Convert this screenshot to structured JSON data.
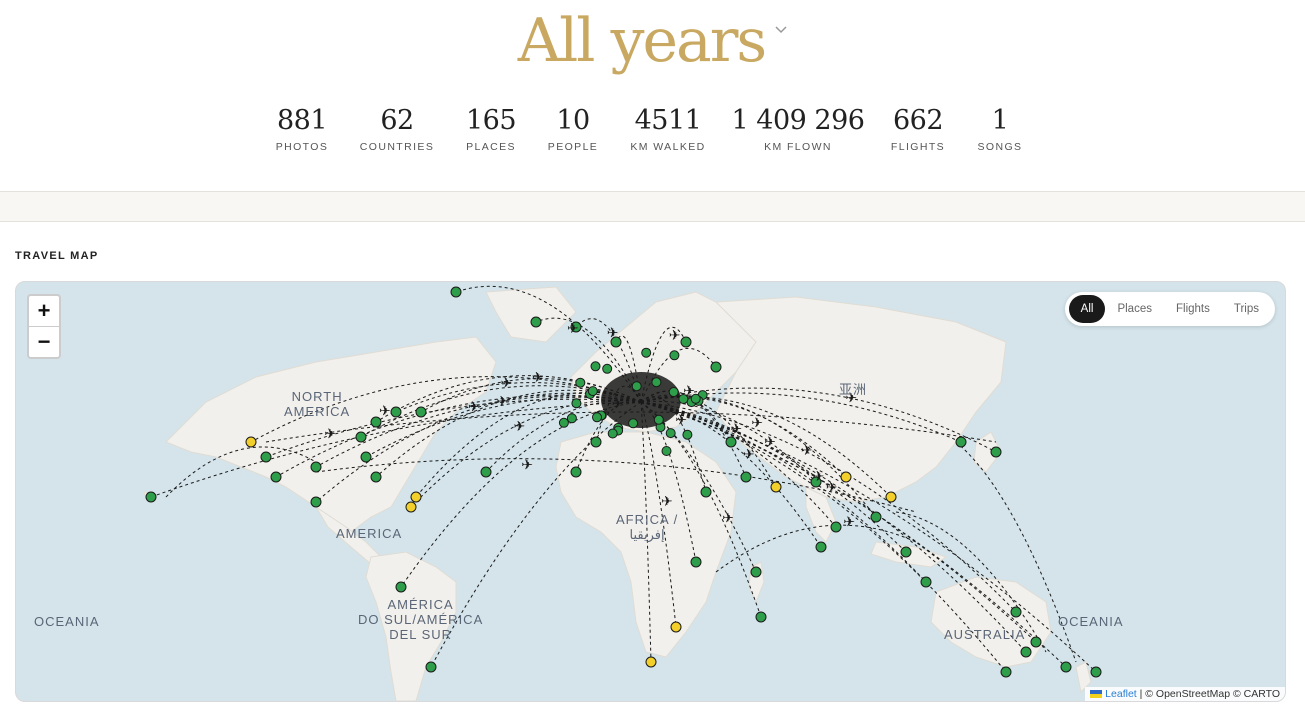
{
  "header": {
    "title": "All years"
  },
  "stats": [
    {
      "value": "881",
      "label": "PHOTOS"
    },
    {
      "value": "62",
      "label": "COUNTRIES"
    },
    {
      "value": "165",
      "label": "PLACES"
    },
    {
      "value": "10",
      "label": "PEOPLE"
    },
    {
      "value": "4511",
      "label": "KM WALKED"
    },
    {
      "value": "1 409 296",
      "label": "KM FLOWN"
    },
    {
      "value": "662",
      "label": "FLIGHTS"
    },
    {
      "value": "1",
      "label": "SONGS"
    }
  ],
  "section": {
    "title": "TRAVEL MAP"
  },
  "map": {
    "zoom_in": "+",
    "zoom_out": "−",
    "filters": [
      "All",
      "Places",
      "Flights",
      "Trips"
    ],
    "active_filter": "All",
    "labels": {
      "north_america": [
        "NORTH",
        "AMERICA"
      ],
      "central_america": "AMERICA",
      "south_america": [
        "AMÉRICA",
        "DO SUL/AMÉRICA",
        "DEL SUR"
      ],
      "africa": [
        "AFRICA /",
        "إفريقيا"
      ],
      "asia": "亚洲",
      "australia": "AUSTRALIA",
      "oceania_left": "OCEANIA",
      "oceania_right": "OCEANIA"
    },
    "attribution": {
      "leaflet": "Leaflet",
      "rest": "| © OpenStreetMap © CARTO"
    },
    "colors": {
      "water": "#d4e4ea",
      "land": "#f2f0ec",
      "place_marker": "#2e9e4b",
      "trip_marker": "#f2cf2a",
      "flight_path": "#1a1a1a"
    }
  }
}
